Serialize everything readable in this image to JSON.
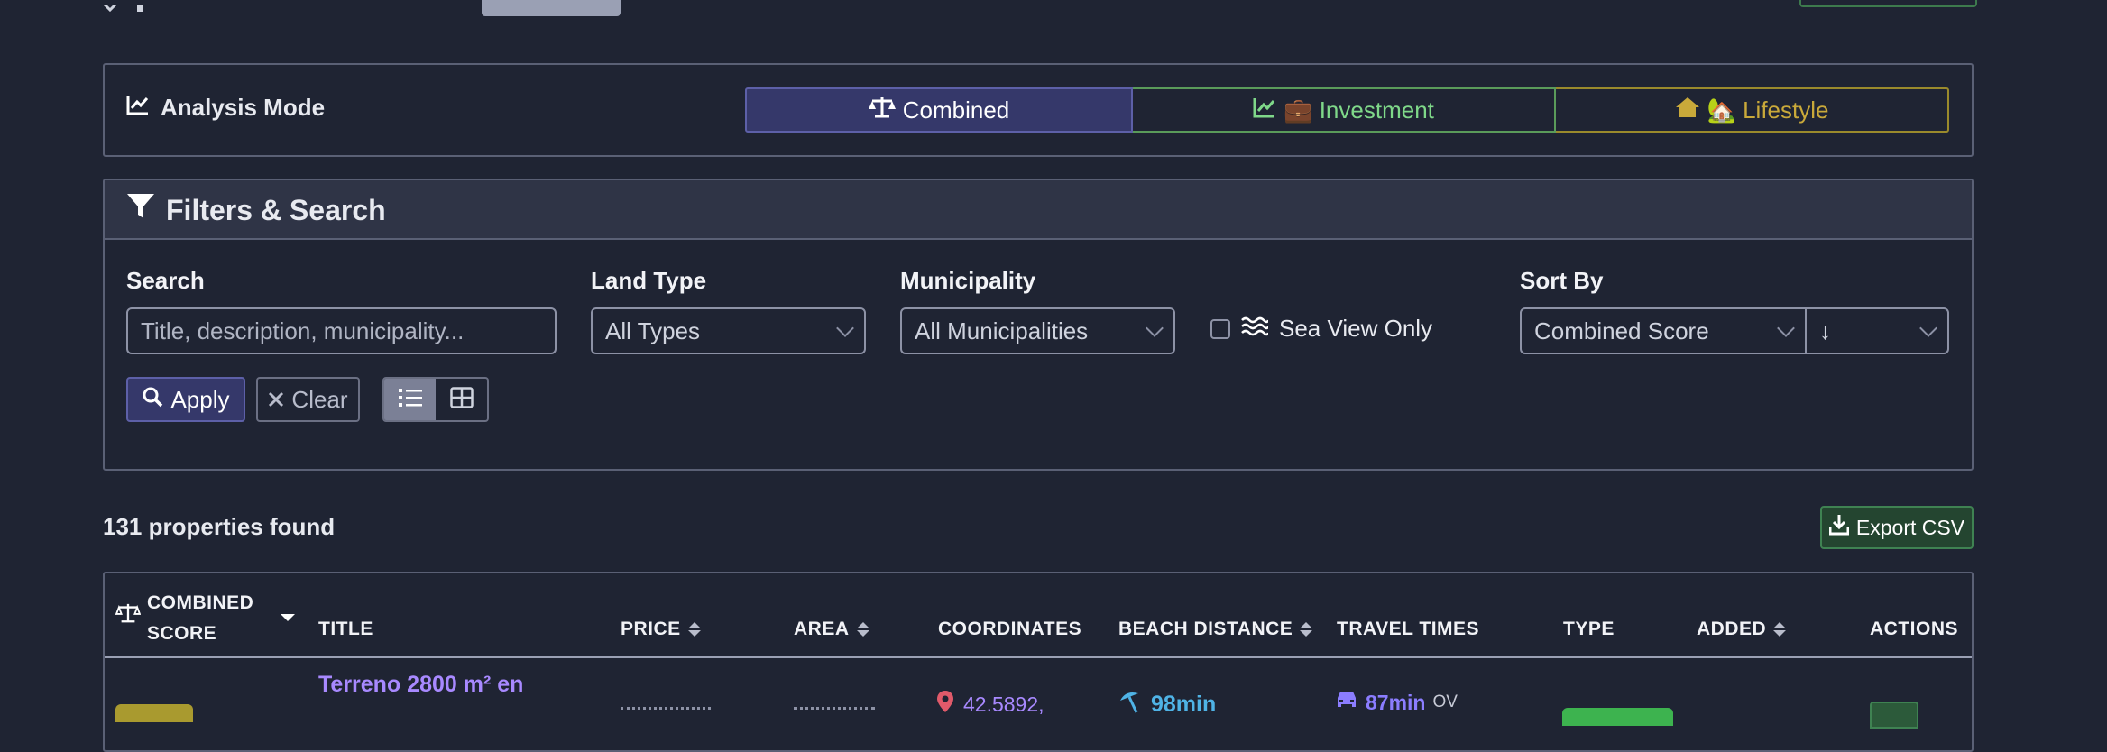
{
  "analysis": {
    "title": "Analysis Mode",
    "modes": [
      {
        "label": "Combined",
        "active": true
      },
      {
        "label": "💼 Investment",
        "active": false
      },
      {
        "label": "🏡 Lifestyle",
        "active": false
      }
    ]
  },
  "filters": {
    "title": "Filters & Search",
    "search_label": "Search",
    "search_placeholder": "Title, description, municipality...",
    "land_type_label": "Land Type",
    "land_type_value": "All Types",
    "municipality_label": "Municipality",
    "municipality_value": "All Municipalities",
    "sea_view_label": "Sea View Only",
    "sort_label": "Sort By",
    "sort_value": "Combined Score",
    "sort_dir": "↓",
    "apply_label": "Apply",
    "clear_label": "Clear"
  },
  "results": {
    "count_text": "131 properties found",
    "export_label": "Export CSV"
  },
  "table": {
    "headers": {
      "score_line1": "COMBINED",
      "score_line2": "SCORE",
      "title": "TITLE",
      "price": "PRICE",
      "area": "AREA",
      "coordinates": "COORDINATES",
      "beach": "BEACH DISTANCE",
      "travel": "TRAVEL TIMES",
      "type": "TYPE",
      "added": "ADDED",
      "actions": "ACTIONS"
    },
    "row": {
      "title_line1": "Terreno 2800 m² en",
      "coordinates": "42.5892,",
      "beach": "98min",
      "travel": "87min",
      "travel_suffix": "OV"
    }
  }
}
